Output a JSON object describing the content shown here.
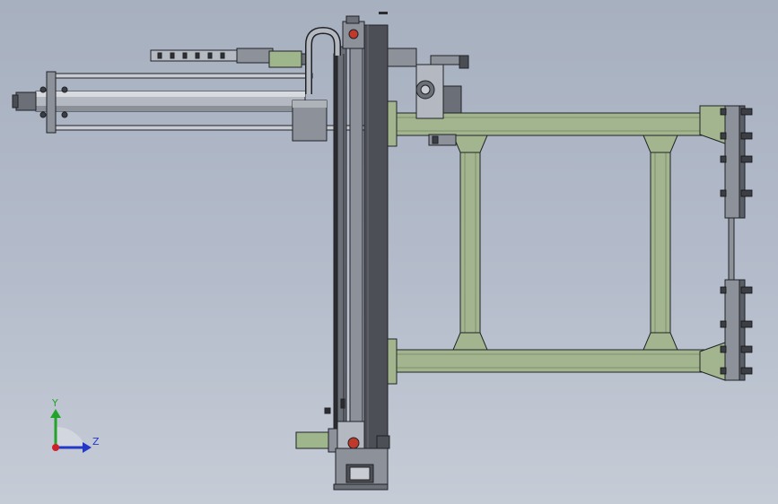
{
  "viewport": {
    "background_top": "#a7b0bf",
    "background_bottom": "#c6ccd6"
  },
  "colors": {
    "frame_green": "#a3b58f",
    "frame_green_dark": "#8a9c76",
    "steel_dark": "#4d4f56",
    "steel_mid": "#8c919a",
    "steel_light": "#c9ccd2",
    "outline": "#202226",
    "accent_red": "#c0392b",
    "motor_green": "#9fb58c"
  },
  "triad": {
    "y_label": "Y",
    "z_label": "Z",
    "y_color": "#22a32a",
    "z_color": "#2438c8",
    "origin_color": "#d0202a"
  }
}
